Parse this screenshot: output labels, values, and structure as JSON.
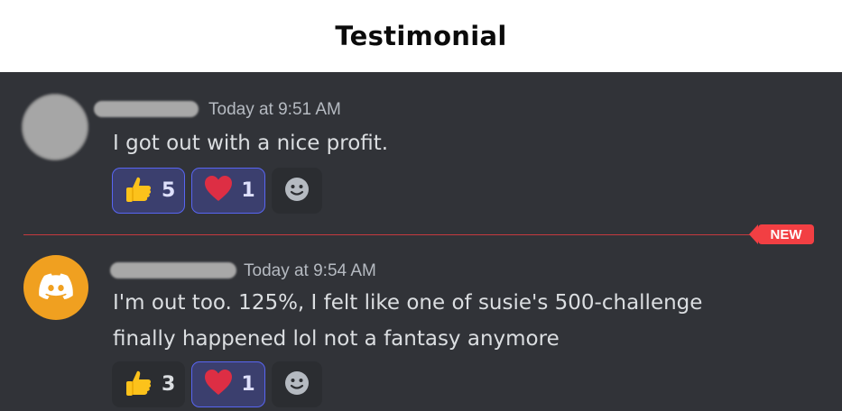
{
  "header": {
    "title": "Testimonial"
  },
  "badge": {
    "new_label": "NEW"
  },
  "messages": [
    {
      "timestamp": "Today at 9:51 AM",
      "text": "I got out with a nice profit.",
      "reactions": [
        {
          "emoji": "thumbs-up",
          "count": "5",
          "active": true
        },
        {
          "emoji": "red-heart",
          "count": "1",
          "active": true
        }
      ]
    },
    {
      "timestamp": "Today at 9:54 AM",
      "text_line1": "I'm out too. 125%, I felt like one of susie's 500-challenge",
      "text_line2": "finally happened lol not a fantasy anymore",
      "reactions": [
        {
          "emoji": "thumbs-up",
          "count": "3",
          "active": false
        },
        {
          "emoji": "red-heart",
          "count": "1",
          "active": true
        }
      ]
    }
  ],
  "colors": {
    "chat_background": "#313338",
    "accent": "#5865f2",
    "new_badge": "#f23f43",
    "discord_avatar": "#f0a020"
  }
}
